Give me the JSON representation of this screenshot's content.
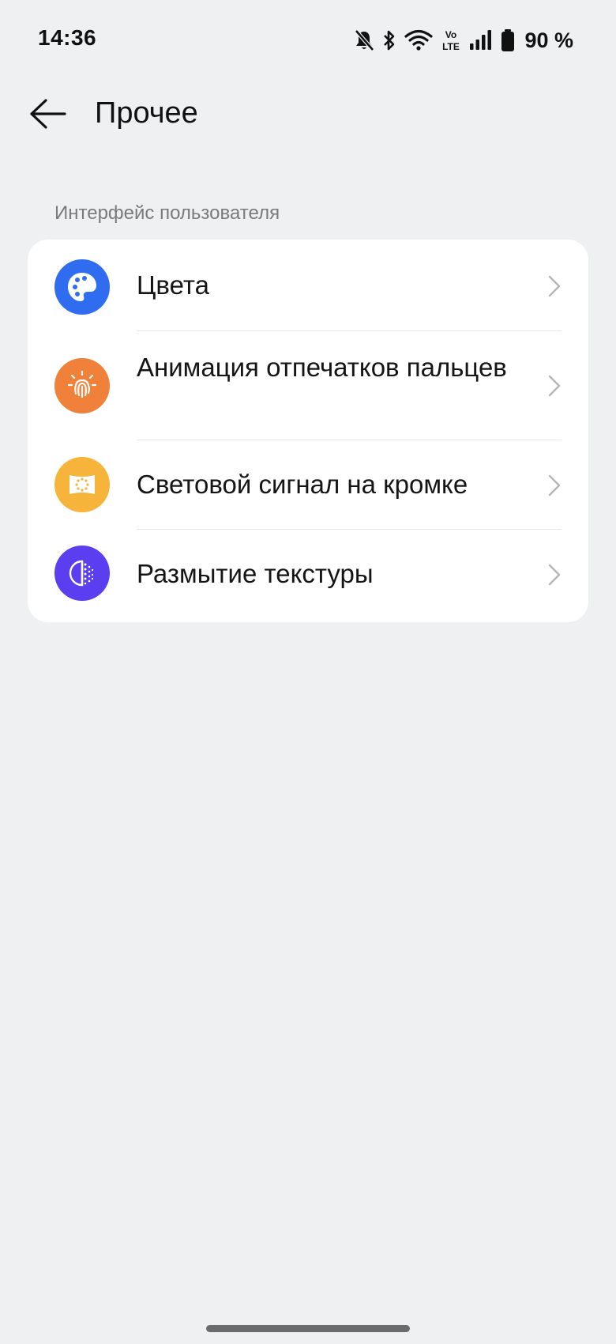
{
  "status_bar": {
    "time": "14:36",
    "battery_text": "90 %",
    "icons": [
      "bell-muted-icon",
      "bluetooth-icon",
      "wifi-icon",
      "volte-icon",
      "signal-icon",
      "battery-icon"
    ],
    "volte_top": "Vo",
    "volte_bottom": "LTE"
  },
  "header": {
    "title": "Прочее",
    "back_icon": "arrow-left-icon"
  },
  "section": {
    "label": "Интерфейс пользователя"
  },
  "items": [
    {
      "label": "Цвета",
      "icon": "palette-icon",
      "color": "#2f6cf0"
    },
    {
      "label": "Анимация отпечатков пальцев",
      "icon": "fingerprint-icon",
      "color": "#f0813a"
    },
    {
      "label": "Световой сигнал на кромке",
      "icon": "edge-light-icon",
      "color": "#f6b43a"
    },
    {
      "label": "Размытие текстуры",
      "icon": "texture-blur-icon",
      "color": "#5b3ef0"
    }
  ],
  "colors": {
    "background": "#eff0f2",
    "card": "#ffffff",
    "secondary_text": "#7a7a7e",
    "chevron": "#b5b5b8"
  }
}
